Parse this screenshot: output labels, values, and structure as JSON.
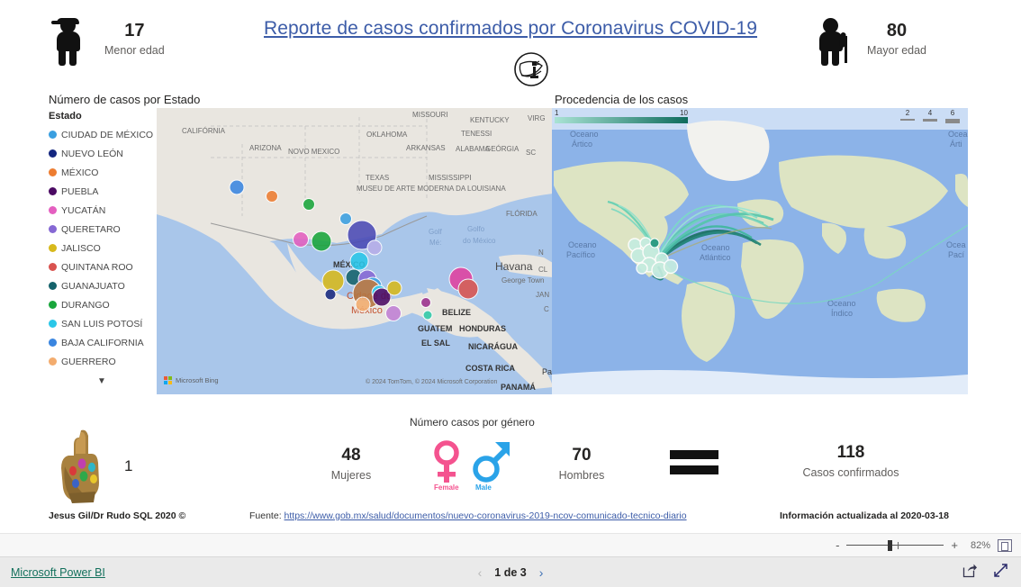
{
  "report": {
    "title": "Reporte de casos confirmados por Coronavirus COVID-19",
    "virus_badge_icon": "coronavirus-badge-icon"
  },
  "kpi_header": [
    {
      "id": "menor-edad",
      "icon": "child-person-icon",
      "value": "17",
      "caption": "Menor edad"
    },
    {
      "id": "mayor-edad",
      "icon": "elderly-person-cane-icon",
      "value": "80",
      "caption": "Mayor edad"
    }
  ],
  "visuals": {
    "estado_title": "Número de casos por Estado",
    "procedencia_title": "Procedencia de los casos"
  },
  "legend": {
    "header": "Estado",
    "more_icon": "chevron-down-icon",
    "items": [
      {
        "label": "CIUDAD DE MÉXICO",
        "color": "#3a9fe0"
      },
      {
        "label": "NUEVO LEÓN",
        "color": "#14267f"
      },
      {
        "label": "MÉXICO",
        "color": "#ed7d31"
      },
      {
        "label": "PUEBLA",
        "color": "#4b0a63"
      },
      {
        "label": "YUCATÁN",
        "color": "#e45fc0"
      },
      {
        "label": "QUERETARO",
        "color": "#8668d4"
      },
      {
        "label": "JALISCO",
        "color": "#d7b91c"
      },
      {
        "label": "QUINTANA ROO",
        "color": "#d9534f"
      },
      {
        "label": "GUANAJUATO",
        "color": "#15626b"
      },
      {
        "label": "DURANGO",
        "color": "#19a63c"
      },
      {
        "label": "SAN LUIS POTOSÍ",
        "color": "#2ac7e8"
      },
      {
        "label": "BAJA CALIFORNIA",
        "color": "#3a86e0"
      },
      {
        "label": "GUERRERO",
        "color": "#f3ac6e"
      }
    ]
  },
  "mexico_map": {
    "provider": "Microsoft Bing",
    "credit": "© 2024 TomTom, © 2024 Microsoft Corporation",
    "labels": [
      "CALIFÓRNIA",
      "ARIZONA",
      "NOVO MEXICO",
      "OKLAHOMA",
      "ARKANSAS",
      "MISSOURI",
      "KENTUCKY",
      "TENESSI",
      "VIRG",
      "TEXAS",
      "MISSISSIPPI",
      "ALABAMA",
      "GEÓRGIA",
      "SC",
      "MUSEU DE ARTE MODERNA DA LOUISIANA",
      "FLÓRIDA",
      "Golf Mé:",
      "Golfo do México",
      "MÉXICO",
      "Cidade do México",
      "Havana",
      "George Town",
      "JAM",
      "BELIZE",
      "GUATEM",
      "HONDURAS",
      "EL SAL",
      "NICARÁGUA",
      "COSTA RICA",
      "PANAMÁ",
      "Pa",
      "C"
    ]
  },
  "world_map": {
    "labels": [
      "Oceano Ártico",
      "Oceano Pacífico",
      "Oceano Atlántico",
      "Oceano Índico",
      "Oceano Ártico",
      "Oceano Pacífico"
    ],
    "gradient_legend": {
      "min": "1",
      "max": "10",
      "low_color": "#a9e3d4",
      "high_color": "#0e6b5c"
    },
    "width_legend": [
      {
        "label": "2",
        "thickness": 2
      },
      {
        "label": "4",
        "thickness": 3
      },
      {
        "label": "6",
        "thickness": 5
      }
    ]
  },
  "gender_panel": {
    "title": "Número casos por género",
    "female_label": "Female",
    "male_label": "Male",
    "female_color": "#f4538f",
    "male_color": "#2aa3e8"
  },
  "bottom_kpis": [
    {
      "id": "gauntlet",
      "icon": "infinity-gauntlet-icon",
      "value": "1",
      "caption": ""
    },
    {
      "id": "mujeres",
      "value": "48",
      "caption": "Mujeres"
    },
    {
      "id": "hombres",
      "value": "70",
      "caption": "Hombres"
    },
    {
      "id": "equals",
      "icon": "equals-sign-icon",
      "value": "",
      "caption": ""
    },
    {
      "id": "total",
      "value": "118",
      "caption": "Casos confirmados"
    }
  ],
  "footer": {
    "author": "Jesus Gil/Dr Rudo SQL 2020 ©",
    "source_prefix": "Fuente: ",
    "source_url": "https://www.gob.mx/salud/documentos/nuevo-coronavirus-2019-ncov-comunicado-tecnico-diario",
    "updated": "Información actualizada al 2020-03-18"
  },
  "zoombar": {
    "minus": "-",
    "plus": "+",
    "zoom_level": "82%",
    "fit_icon": "fit-to-page-icon"
  },
  "actionbar": {
    "brand": "Microsoft Power BI",
    "page_label": "1 de 3",
    "prev_icon": "chevron-left-icon",
    "next_icon": "chevron-right-icon",
    "share_icon": "share-icon",
    "fullscreen_icon": "fullscreen-icon"
  }
}
